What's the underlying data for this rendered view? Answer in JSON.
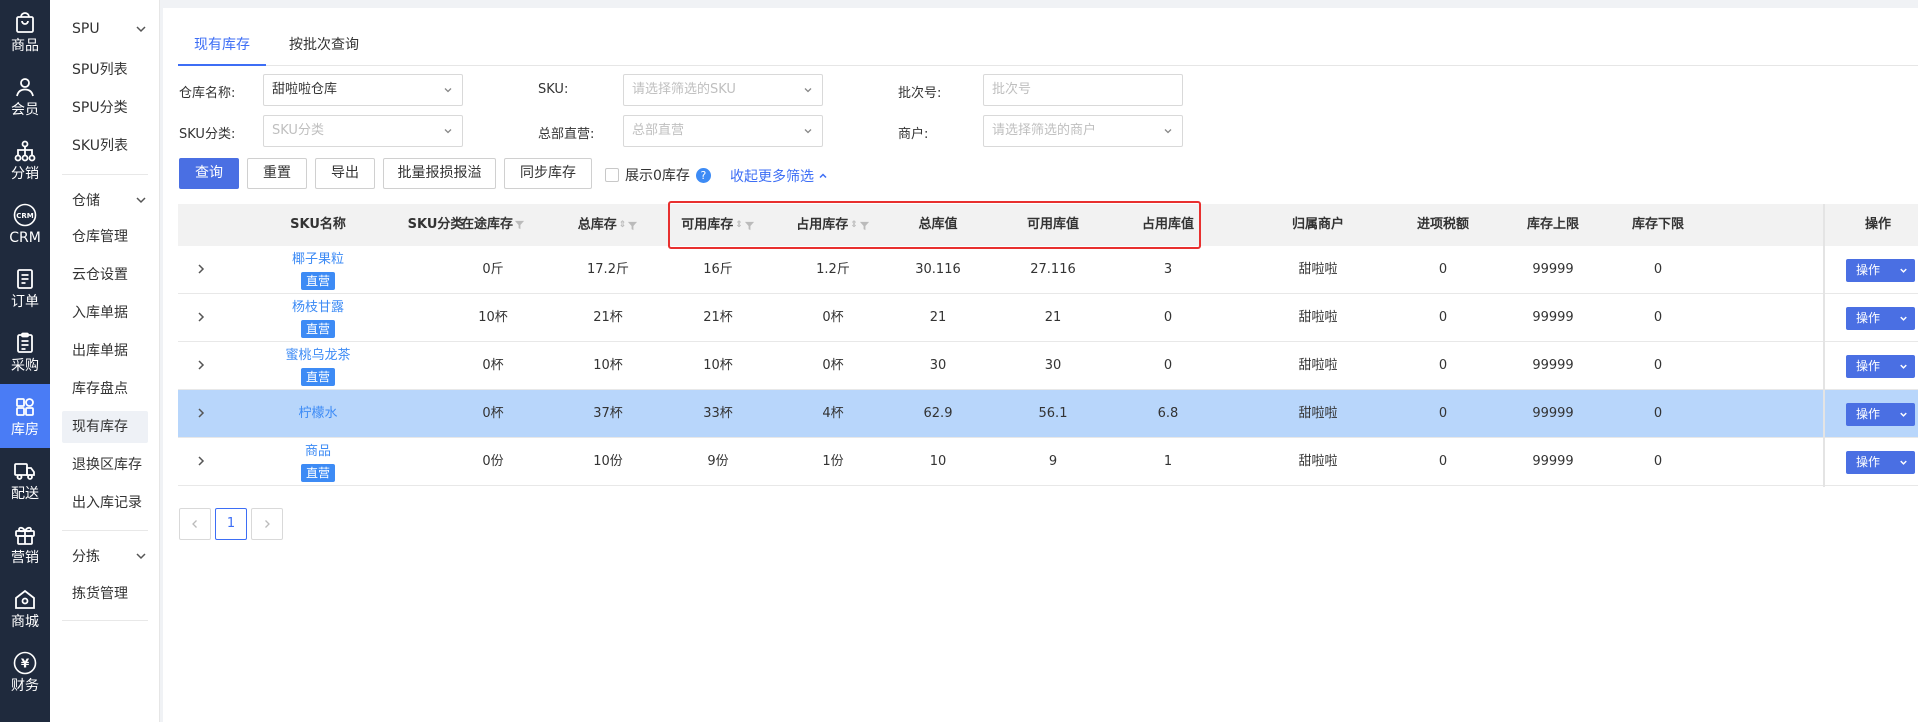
{
  "rail": [
    {
      "label": "商品",
      "icon": "bag-icon"
    },
    {
      "label": "会员",
      "icon": "user-icon"
    },
    {
      "label": "分销",
      "icon": "network-icon"
    },
    {
      "label": "CRM",
      "icon": "crm-icon",
      "icon_text": "CRM"
    },
    {
      "label": "订单",
      "icon": "order-icon"
    },
    {
      "label": "采购",
      "icon": "clipboard-icon"
    },
    {
      "label": "库房",
      "icon": "grid-icon"
    },
    {
      "label": "配送",
      "icon": "truck-icon"
    },
    {
      "label": "营销",
      "icon": "gift-icon"
    },
    {
      "label": "商城",
      "icon": "home-icon"
    },
    {
      "label": "财务",
      "icon": "yen-icon",
      "icon_text": "¥"
    }
  ],
  "menu": {
    "groups": [
      {
        "label": "SPU",
        "items": [
          "SPU列表",
          "SPU分类",
          "SKU列表"
        ]
      },
      {
        "label": "仓储",
        "items": [
          "仓库管理",
          "云仓设置",
          "入库单据",
          "出库单据",
          "库存盘点",
          "现有库存",
          "退换区库存",
          "出入库记录"
        ]
      },
      {
        "label": "分拣",
        "items": [
          "拣货管理"
        ]
      }
    ],
    "active_item": "现有库存"
  },
  "tabs": [
    {
      "label": "现有库存",
      "active": true
    },
    {
      "label": "按批次查询",
      "active": false
    }
  ],
  "filters": {
    "warehouse": {
      "label": "仓库名称:",
      "value": "甜啦啦仓库"
    },
    "sku": {
      "label": "SKU:",
      "placeholder": "请选择筛选的SKU"
    },
    "batch": {
      "label": "批次号:",
      "placeholder": "批次号"
    },
    "sku_category": {
      "label": "SKU分类:",
      "placeholder": "SKU分类"
    },
    "hq_direct": {
      "label": "总部直营:",
      "placeholder": "总部直营"
    },
    "merchant": {
      "label": "商户:",
      "placeholder": "请选择筛选的商户"
    }
  },
  "actions": {
    "query": "查询",
    "reset": "重置",
    "export": "导出",
    "batch_report": "批量报损报溢",
    "sync": "同步库存",
    "show_zero": "展示0库存",
    "help": "?",
    "collapse": "收起更多筛选"
  },
  "table": {
    "headers": {
      "sku_name": "SKU名称",
      "sku_category": "SKU分类",
      "in_transit": "在途库存",
      "total": "总库存",
      "available": "可用库存",
      "occupied": "占用库存",
      "total_value": "总库值",
      "available_value": "可用库值",
      "occupied_value": "占用库值",
      "merchant": "归属商户",
      "input_tax": "进项税额",
      "upper": "库存上限",
      "lower": "库存下限",
      "ops": "操作"
    },
    "rows": [
      {
        "sku_name": "椰子果粒",
        "tag": "直营",
        "sku_category": "",
        "in_transit": "0斤",
        "total": "17.2斤",
        "available": "16斤",
        "occupied": "1.2斤",
        "total_value": "30.116",
        "available_value": "27.116",
        "occupied_value": "3",
        "merchant": "甜啦啦",
        "input_tax": "0",
        "upper": "99999",
        "lower": "0",
        "op": "操作"
      },
      {
        "sku_name": "杨枝甘露",
        "tag": "直营",
        "sku_category": "",
        "in_transit": "10杯",
        "total": "21杯",
        "available": "21杯",
        "occupied": "0杯",
        "total_value": "21",
        "available_value": "21",
        "occupied_value": "0",
        "merchant": "甜啦啦",
        "input_tax": "0",
        "upper": "99999",
        "lower": "0",
        "op": "操作"
      },
      {
        "sku_name": "蜜桃乌龙茶",
        "tag": "直营",
        "sku_category": "",
        "in_transit": "0杯",
        "total": "10杯",
        "available": "10杯",
        "occupied": "0杯",
        "total_value": "30",
        "available_value": "30",
        "occupied_value": "0",
        "merchant": "甜啦啦",
        "input_tax": "0",
        "upper": "99999",
        "lower": "0",
        "op": "操作"
      },
      {
        "sku_name": "柠檬水",
        "tag": "",
        "sku_category": "",
        "in_transit": "0杯",
        "total": "37杯",
        "available": "33杯",
        "occupied": "4杯",
        "total_value": "62.9",
        "available_value": "56.1",
        "occupied_value": "6.8",
        "merchant": "甜啦啦",
        "input_tax": "0",
        "upper": "99999",
        "lower": "0",
        "op": "操作",
        "highlighted": true
      },
      {
        "sku_name": "商品",
        "tag": "直营",
        "sku_category": "",
        "in_transit": "0份",
        "total": "10份",
        "available": "9份",
        "occupied": "1份",
        "total_value": "10",
        "available_value": "9",
        "occupied_value": "1",
        "merchant": "甜啦啦",
        "input_tax": "0",
        "upper": "99999",
        "lower": "0",
        "op": "操作"
      }
    ]
  },
  "pagination": {
    "current": "1"
  },
  "colors": {
    "accent": "#3d6ef5",
    "primary_button": "#4a6fe3",
    "rail_bg": "#1f2a3d",
    "rail_active": "#4a7cf5",
    "highlight_row": "#b8d6fb",
    "annotation": "#e8302f"
  }
}
